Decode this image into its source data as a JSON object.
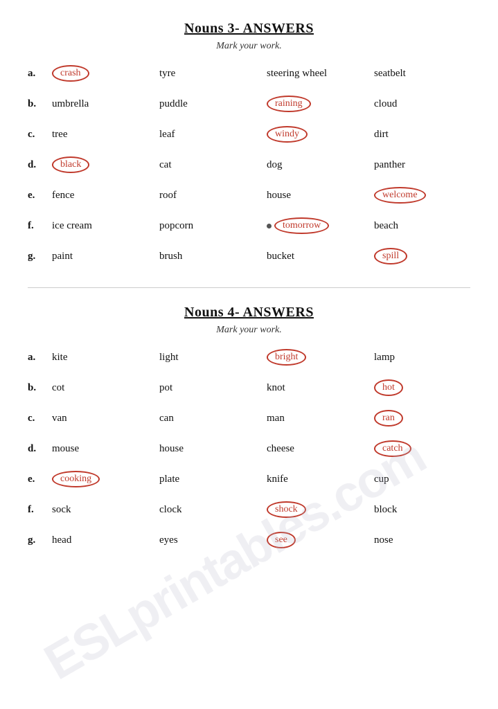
{
  "watermark": "ESLprintables.com",
  "section1": {
    "title": "Nouns 3- ANSWERS",
    "subtitle": "Mark your work.",
    "rows": [
      {
        "label": "a.",
        "cols": [
          {
            "text": "crash",
            "circled": true
          },
          {
            "text": "tyre",
            "circled": false
          },
          {
            "text": "steering wheel",
            "circled": false
          },
          {
            "text": "seatbelt",
            "circled": false
          }
        ]
      },
      {
        "label": "b.",
        "cols": [
          {
            "text": "umbrella",
            "circled": false
          },
          {
            "text": "puddle",
            "circled": false
          },
          {
            "text": "raining",
            "circled": true
          },
          {
            "text": "cloud",
            "circled": false
          }
        ]
      },
      {
        "label": "c.",
        "cols": [
          {
            "text": "tree",
            "circled": false
          },
          {
            "text": "leaf",
            "circled": false
          },
          {
            "text": "windy",
            "circled": true
          },
          {
            "text": "dirt",
            "circled": false
          }
        ]
      },
      {
        "label": "d.",
        "cols": [
          {
            "text": "black",
            "circled": true
          },
          {
            "text": "cat",
            "circled": false
          },
          {
            "text": "dog",
            "circled": false
          },
          {
            "text": "panther",
            "circled": false
          }
        ]
      },
      {
        "label": "e.",
        "cols": [
          {
            "text": "fence",
            "circled": false
          },
          {
            "text": "roof",
            "circled": false
          },
          {
            "text": "house",
            "circled": false
          },
          {
            "text": "welcome",
            "circled": true
          }
        ]
      },
      {
        "label": "f.",
        "cols": [
          {
            "text": "ice cream",
            "circled": false
          },
          {
            "text": "popcorn",
            "circled": false
          },
          {
            "text": "tomorrow",
            "circled": true,
            "dot": true
          },
          {
            "text": "beach",
            "circled": false
          }
        ]
      },
      {
        "label": "g.",
        "cols": [
          {
            "text": "paint",
            "circled": false
          },
          {
            "text": "brush",
            "circled": false
          },
          {
            "text": "bucket",
            "circled": false
          },
          {
            "text": "spill",
            "circled": true
          }
        ]
      }
    ]
  },
  "section2": {
    "title": "Nouns 4- ANSWERS",
    "subtitle": "Mark your work.",
    "rows": [
      {
        "label": "a.",
        "cols": [
          {
            "text": "kite",
            "circled": false
          },
          {
            "text": "light",
            "circled": false
          },
          {
            "text": "bright",
            "circled": true
          },
          {
            "text": "lamp",
            "circled": false
          }
        ]
      },
      {
        "label": "b.",
        "cols": [
          {
            "text": "cot",
            "circled": false
          },
          {
            "text": "pot",
            "circled": false
          },
          {
            "text": "knot",
            "circled": false
          },
          {
            "text": "hot",
            "circled": true
          }
        ]
      },
      {
        "label": "c.",
        "cols": [
          {
            "text": "van",
            "circled": false
          },
          {
            "text": "can",
            "circled": false
          },
          {
            "text": "man",
            "circled": false
          },
          {
            "text": "ran",
            "circled": true
          }
        ]
      },
      {
        "label": "d.",
        "cols": [
          {
            "text": "mouse",
            "circled": false
          },
          {
            "text": "house",
            "circled": false
          },
          {
            "text": "cheese",
            "circled": false
          },
          {
            "text": "catch",
            "circled": true
          }
        ]
      },
      {
        "label": "e.",
        "cols": [
          {
            "text": "cooking",
            "circled": true
          },
          {
            "text": "plate",
            "circled": false
          },
          {
            "text": "knife",
            "circled": false
          },
          {
            "text": "cup",
            "circled": false
          }
        ]
      },
      {
        "label": "f.",
        "cols": [
          {
            "text": "sock",
            "circled": false
          },
          {
            "text": "clock",
            "circled": false
          },
          {
            "text": "shock",
            "circled": true
          },
          {
            "text": "block",
            "circled": false
          }
        ]
      },
      {
        "label": "g.",
        "cols": [
          {
            "text": "head",
            "circled": false
          },
          {
            "text": "eyes",
            "circled": false
          },
          {
            "text": "see",
            "circled": true
          },
          {
            "text": "nose",
            "circled": false
          }
        ]
      }
    ]
  }
}
